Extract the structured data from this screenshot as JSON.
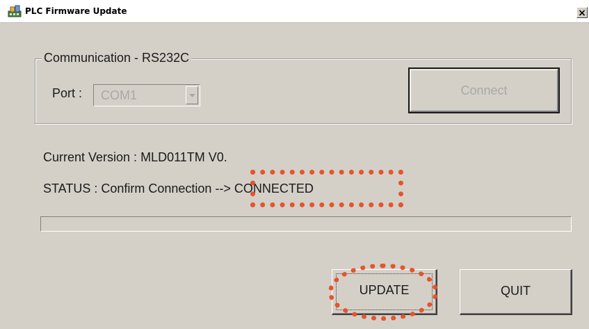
{
  "window": {
    "title": "PLC Firmware Update",
    "close_glyph": "×",
    "app_icon": "plc-app-icon"
  },
  "communication": {
    "group_label": "Communication - RS232C",
    "port_label": "Port :",
    "port_value": "COM1",
    "connect_label": "Connect",
    "port_enabled": false,
    "connect_enabled": false
  },
  "info": {
    "version_text": "Current Version : MLD011TM V0.",
    "status_text": "STATUS : Confirm Connection --> CONNECTED"
  },
  "progress": {
    "value_percent": 0
  },
  "actions": {
    "update_label": "UPDATE",
    "quit_label": "QUIT"
  },
  "annotations": {
    "highlight_color": "#e8532b"
  }
}
